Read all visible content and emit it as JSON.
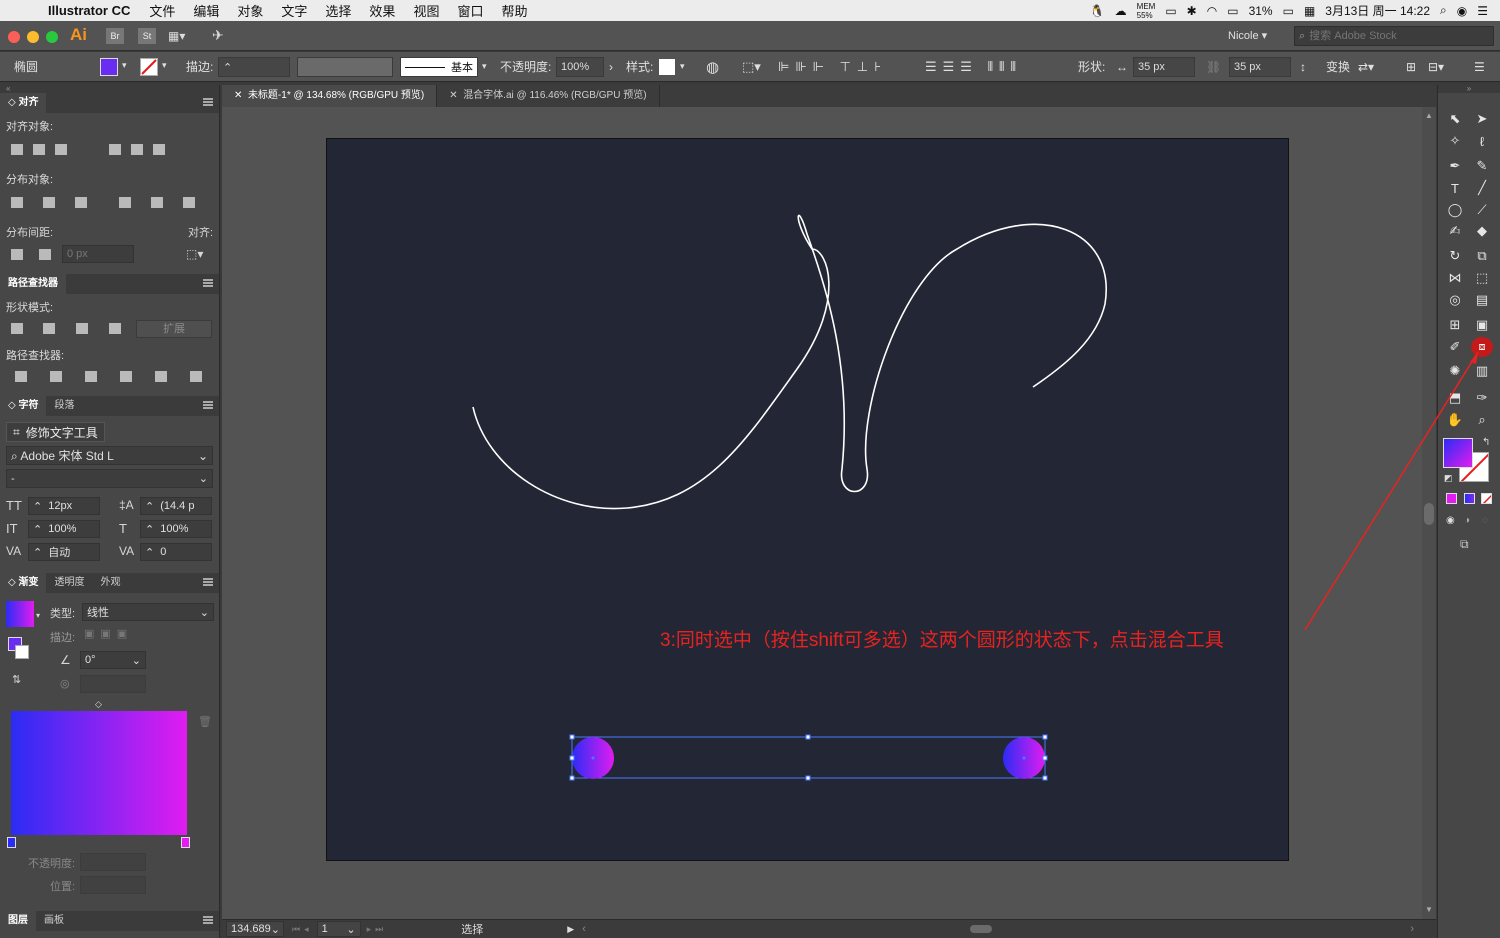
{
  "menubar": {
    "app_name": "Illustrator CC",
    "items": [
      "文件",
      "编辑",
      "对象",
      "文字",
      "选择",
      "效果",
      "视图",
      "窗口",
      "帮助"
    ],
    "mem_label": "MEM",
    "mem_value": "55%",
    "battery": "31%",
    "datetime": "3月13日 周一 14:22"
  },
  "appbar": {
    "logo": "Ai",
    "br": "Br",
    "st": "St",
    "user": "Nicole",
    "search_placeholder": "搜索 Adobe Stock"
  },
  "control": {
    "object_type": "椭圆",
    "stroke_label": "描边:",
    "stroke_style": "基本",
    "opacity_label": "不透明度:",
    "opacity_value": "100%",
    "style_label": "样式:",
    "shape_label": "形状:",
    "width_value": "35 px",
    "height_value": "35 px",
    "transform_label": "变换",
    "fill_color": "#6a2cf0"
  },
  "doctabs": [
    {
      "label": "未标题-1* @ 134.68% (RGB/GPU 预览)",
      "active": true
    },
    {
      "label": "混合字体.ai @ 116.46% (RGB/GPU 预览)",
      "active": false
    }
  ],
  "align_panel": {
    "tab": "对齐",
    "align_objects": "对齐对象:",
    "distribute_objects": "分布对象:",
    "distribute_spacing": "分布间距:",
    "align_to": "对齐:",
    "spacing_value": "0 px"
  },
  "pathfinder_panel": {
    "tab": "路径查找器",
    "shape_modes": "形状模式:",
    "expand": "扩展",
    "pathfinders": "路径查找器:"
  },
  "character_panel": {
    "tabs": [
      "字符",
      "段落"
    ],
    "touch_type": "修饰文字工具",
    "font_family": "Adobe 宋体 Std L",
    "font_style": "-",
    "font_size": "12px",
    "leading": "(14.4 p",
    "vscale": "100%",
    "hscale": "100%",
    "kerning": "自动",
    "tracking": "0"
  },
  "gradient_panel": {
    "tabs": [
      "渐变",
      "透明度",
      "外观"
    ],
    "type_label": "类型:",
    "type_value": "线性",
    "stroke_label": "描边:",
    "angle": "0°",
    "opacity_label": "不透明度:",
    "location_label": "位置:",
    "start_color": "#2b2cf5",
    "end_color": "#e11cf0"
  },
  "layers_tabs": [
    "图层",
    "画板"
  ],
  "statusbar": {
    "zoom": "134.689",
    "artboard_num": "1",
    "tool_name": "选择"
  },
  "annotation": "3:同时选中（按住shift可多选）这两个圆形的状态下，点击混合工具",
  "colors": {
    "artboard": "#232634",
    "annotation": "#e8231f",
    "selection": "#4a7bff"
  }
}
